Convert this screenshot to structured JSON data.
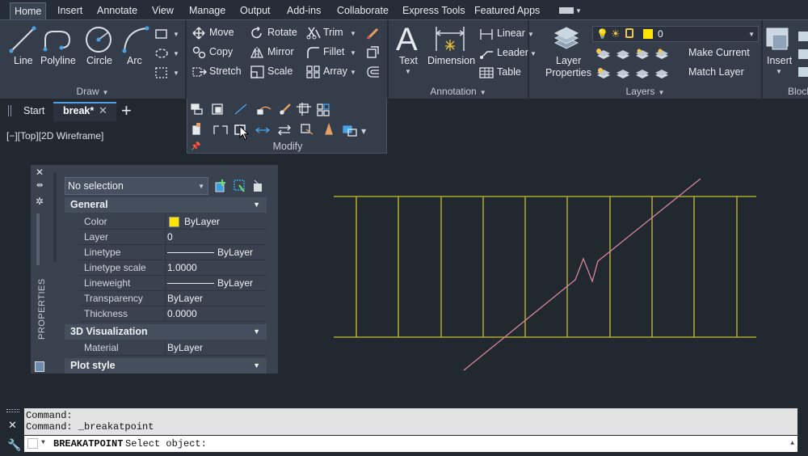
{
  "ribbon_tabs": [
    "Home",
    "Insert",
    "Annotate",
    "View",
    "Manage",
    "Output",
    "Add-ins",
    "Collaborate",
    "Express Tools",
    "Featured Apps"
  ],
  "draw": {
    "title": "Draw",
    "tools": [
      "Line",
      "Polyline",
      "Circle",
      "Arc"
    ]
  },
  "modify": {
    "title": "Modify",
    "rows": [
      [
        "Move",
        "Rotate",
        "Trim"
      ],
      [
        "Copy",
        "Mirror",
        "Fillet"
      ],
      [
        "Stretch",
        "Scale",
        "Array"
      ]
    ]
  },
  "annotation": {
    "title": "Annotation",
    "text": "Text",
    "dimension": "Dimension",
    "linear": "Linear",
    "leader": "Leader",
    "table": "Table"
  },
  "layers": {
    "title": "Layers",
    "layer_properties_1": "Layer",
    "layer_properties_2": "Properties",
    "current_layer": "0",
    "make_current": "Make Current",
    "match_layer": "Match Layer"
  },
  "block": {
    "insert": "Insert",
    "title": "Block"
  },
  "file_tabs": {
    "start": "Start",
    "active": "break*"
  },
  "viewport_label": "[−][Top][2D Wireframe]",
  "properties": {
    "palette_title": "PROPERTIES",
    "selection": "No selection",
    "groups": {
      "general": "General",
      "viz": "3D Visualization",
      "plot": "Plot style"
    },
    "general_rows": [
      {
        "k": "Color",
        "v": "ByLayer"
      },
      {
        "k": "Layer",
        "v": "0"
      },
      {
        "k": "Linetype",
        "v": "ByLayer"
      },
      {
        "k": "Linetype scale",
        "v": "1.0000"
      },
      {
        "k": "Lineweight",
        "v": "ByLayer"
      },
      {
        "k": "Transparency",
        "v": "ByLayer"
      },
      {
        "k": "Thickness",
        "v": "0.0000"
      }
    ],
    "viz_rows": [
      {
        "k": "Material",
        "v": "ByLayer"
      }
    ]
  },
  "command": {
    "history": [
      "Command:",
      "Command: _breakatpoint"
    ],
    "prompt_cmd": "BREAKATPOINT",
    "prompt_text": "Select object:"
  },
  "colors": {
    "drawing_lines": "#c8c232",
    "break_line": "#d8869e",
    "color_swatch": "#ffe400"
  }
}
